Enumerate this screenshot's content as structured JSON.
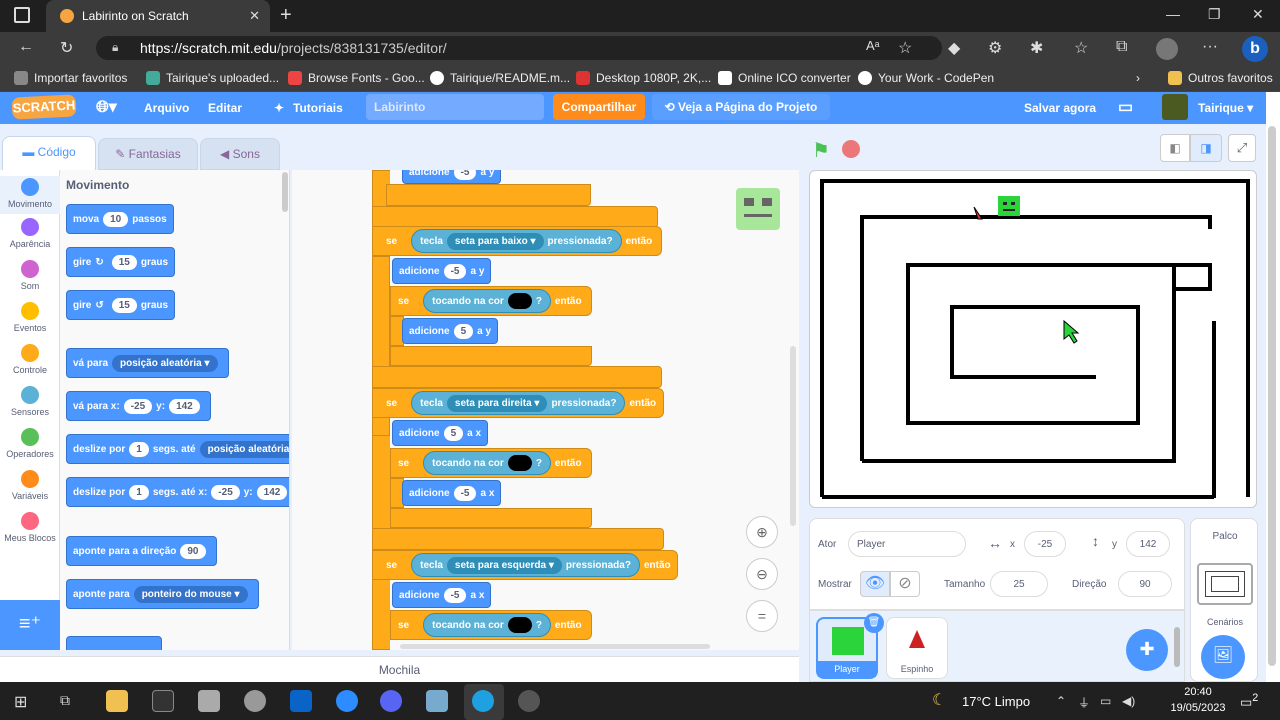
{
  "browser": {
    "tab_title": "Labirinto on Scratch",
    "url_host": "https://scratch.mit.edu",
    "url_path": "/projects/838131735/editor/",
    "bookmarks": [
      "Importar favoritos",
      "Tairique's uploaded...",
      "Browse Fonts - Goo...",
      "Tairique/README.m...",
      "Desktop 1080P, 2K,...",
      "Online ICO converter",
      "Your Work - CodePen"
    ],
    "other_favorites": "Outros favoritos"
  },
  "scratch_header": {
    "logo": "SCRATCH",
    "menu": [
      "Arquivo",
      "Editar",
      "Tutoriais"
    ],
    "project_name": "Labirinto",
    "share": "Compartilhar",
    "see_project": "Veja a Página do Projeto",
    "save_now": "Salvar agora",
    "user": "Tairique"
  },
  "editor_tabs": [
    "Código",
    "Fantasias",
    "Sons"
  ],
  "categories": [
    {
      "label": "Movimento",
      "color": "#4c97ff"
    },
    {
      "label": "Aparência",
      "color": "#9966ff"
    },
    {
      "label": "Som",
      "color": "#cf63cf"
    },
    {
      "label": "Eventos",
      "color": "#ffbf00"
    },
    {
      "label": "Controle",
      "color": "#ffab19"
    },
    {
      "label": "Sensores",
      "color": "#5cb1d6"
    },
    {
      "label": "Operadores",
      "color": "#59c059"
    },
    {
      "label": "Variáveis",
      "color": "#ff8c1a"
    },
    {
      "label": "Meus Blocos",
      "color": "#ff6680"
    }
  ],
  "palette": {
    "heading": "Movimento",
    "move": {
      "a": "mova",
      "n": "10",
      "b": "passos"
    },
    "turn_right": {
      "a": "gire",
      "n": "15",
      "b": "graus"
    },
    "turn_left": {
      "a": "gire",
      "n": "15",
      "b": "graus"
    },
    "goto": {
      "a": "vá para",
      "d": "posição aleatória"
    },
    "goto_xy": {
      "a": "vá para x:",
      "x": "-25",
      "y_label": "y:",
      "y": "142"
    },
    "glide": {
      "a": "deslize por",
      "n": "1",
      "b": "segs. até",
      "d": "posição aleatória"
    },
    "glide_xy": {
      "a": "deslize por",
      "n": "1",
      "b": "segs. até x:",
      "x": "-25",
      "y_label": "y:",
      "y": "142"
    },
    "point_dir": {
      "a": "aponte para a direção",
      "n": "90"
    },
    "point_to": {
      "a": "aponte para",
      "d": "ponteiro do mouse"
    }
  },
  "script": {
    "top_add": {
      "a": "adicione",
      "n": "-5",
      "b": "a y"
    },
    "if_down": {
      "se": "se",
      "tecla": "tecla",
      "key": "seta para baixo",
      "press": "pressionada?",
      "then": "então"
    },
    "add_y_neg": {
      "a": "adicione",
      "n": "-5",
      "b": "a y"
    },
    "touch1": {
      "se": "se",
      "t": "tocando na cor",
      "q": "?",
      "then": "então"
    },
    "add_y_pos": {
      "a": "adicione",
      "n": "5",
      "b": "a y"
    },
    "if_right": {
      "se": "se",
      "tecla": "tecla",
      "key": "seta para direita",
      "press": "pressionada?",
      "then": "então"
    },
    "add_x_pos": {
      "a": "adicione",
      "n": "5",
      "b": "a x"
    },
    "touch2": {
      "se": "se",
      "t": "tocando na cor",
      "q": "?",
      "then": "então"
    },
    "add_x_neg": {
      "a": "adicione",
      "n": "-5",
      "b": "a x"
    },
    "if_left": {
      "se": "se",
      "tecla": "tecla",
      "key": "seta para esquerda",
      "press": "pressionada?",
      "then": "então"
    },
    "add_x_neg2": {
      "a": "adicione",
      "n": "-5",
      "b": "a x"
    },
    "touch3": {
      "se": "se",
      "t": "tocando na cor",
      "q": "?",
      "then": "então"
    }
  },
  "backpack": "Mochila",
  "sprite_info": {
    "actor_label": "Ator",
    "actor": "Player",
    "x_label": "x",
    "x": "-25",
    "y_label": "y",
    "y": "142",
    "show_label": "Mostrar",
    "size_label": "Tamanho",
    "size": "25",
    "dir_label": "Direção",
    "dir": "90"
  },
  "sprites": [
    "Player",
    "Espinho"
  ],
  "stage_panel": {
    "title": "Palco",
    "backdrops": "Cenários"
  },
  "taskbar": {
    "weather": "17°C  Limpo",
    "time": "20:40",
    "date": "19/05/2023",
    "notif": "2"
  }
}
